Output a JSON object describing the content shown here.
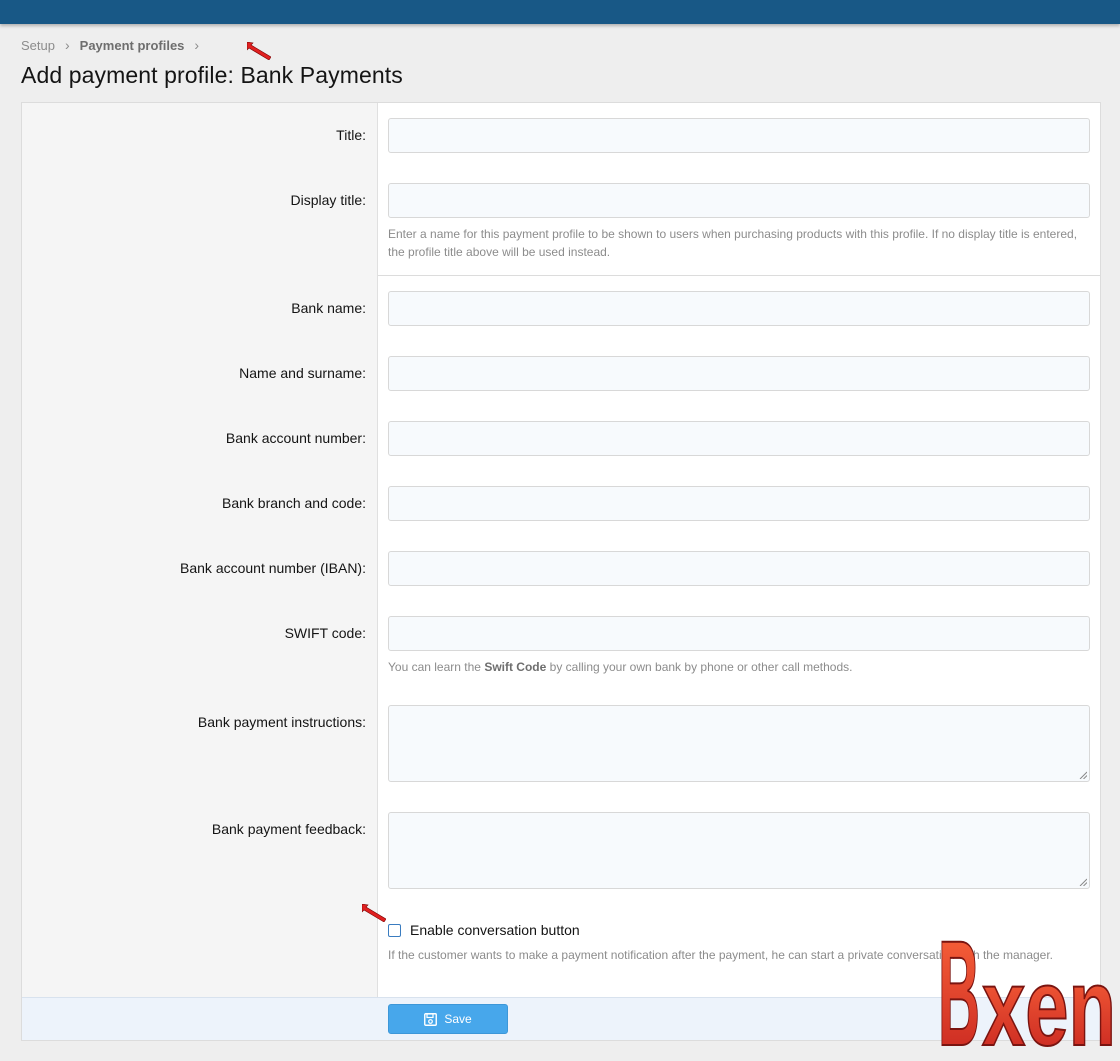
{
  "breadcrumb": {
    "items": [
      "Setup",
      "Payment profiles"
    ],
    "separator": "›"
  },
  "page": {
    "title": "Add payment profile: Bank Payments"
  },
  "form": {
    "title_label": "Title:",
    "display_title_label": "Display title:",
    "display_title_hint": "Enter a name for this payment profile to be shown to users when purchasing products with this profile. If no display title is entered, the profile title above will be used instead.",
    "bank_name_label": "Bank name:",
    "name_surname_label": "Name and surname:",
    "account_number_label": "Bank account number:",
    "branch_code_label": "Bank branch and code:",
    "iban_label": "Bank account number (IBAN):",
    "swift_label": "SWIFT code:",
    "swift_hint_pre": "You can learn the ",
    "swift_hint_bold": "Swift Code",
    "swift_hint_post": " by calling your own bank by phone or other call methods.",
    "instructions_label": "Bank payment instructions:",
    "feedback_label": "Bank payment feedback:",
    "conversation_checkbox_label": "Enable conversation button",
    "conversation_checked": false,
    "conversation_hint": "If the customer wants to make a payment notification after the payment, he can start a private conversation with the manager."
  },
  "actions": {
    "save_label": "Save",
    "save_icon": "save-icon"
  },
  "watermark": {
    "text": "Bxen"
  },
  "colors": {
    "topbar": "#185886",
    "button": "#47a7eb",
    "annotation_arrow": "#e02020"
  }
}
